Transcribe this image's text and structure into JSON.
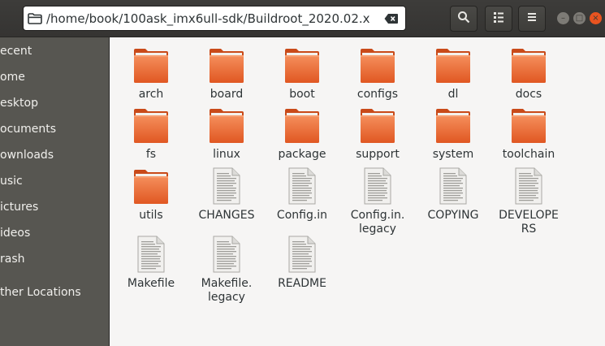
{
  "location": {
    "path": "/home/book/100ask_imx6ull-sdk/Buildroot_2020.02.x"
  },
  "header_buttons": [
    "search-icon",
    "view-list-icon",
    "menu-icon"
  ],
  "window_controls": {
    "minimize": "–",
    "maximize": "□",
    "close": "×"
  },
  "colors": {
    "accent": "#e95420",
    "sidebar_bg": "#575651",
    "header_bg": "#3d3c3a",
    "content_bg": "#f6f5f4"
  },
  "sidebar": {
    "items": [
      {
        "label": "ecent"
      },
      {
        "label": "ome"
      },
      {
        "label": "esktop"
      },
      {
        "label": "ocuments"
      },
      {
        "label": "ownloads"
      },
      {
        "label": "usic"
      },
      {
        "label": "ictures"
      },
      {
        "label": "ideos"
      },
      {
        "label": "rash"
      },
      {
        "label": "ther Locations"
      }
    ]
  },
  "files": [
    {
      "name": "arch",
      "type": "folder"
    },
    {
      "name": "board",
      "type": "folder"
    },
    {
      "name": "boot",
      "type": "folder"
    },
    {
      "name": "configs",
      "type": "folder"
    },
    {
      "name": "dl",
      "type": "folder"
    },
    {
      "name": "docs",
      "type": "folder"
    },
    {
      "name": "fs",
      "type": "folder"
    },
    {
      "name": "linux",
      "type": "folder"
    },
    {
      "name": "package",
      "type": "folder"
    },
    {
      "name": "support",
      "type": "folder"
    },
    {
      "name": "system",
      "type": "folder"
    },
    {
      "name": "toolchain",
      "type": "folder"
    },
    {
      "name": "utils",
      "type": "folder"
    },
    {
      "name": "CHANGES",
      "type": "text-file"
    },
    {
      "name": "Config.in",
      "type": "text-file"
    },
    {
      "name": "Config.in.\nlegacy",
      "type": "text-file"
    },
    {
      "name": "COPYING",
      "type": "text-file"
    },
    {
      "name": "DEVELOPE\nRS",
      "type": "text-file"
    },
    {
      "name": "Makefile",
      "type": "text-file"
    },
    {
      "name": "Makefile.\nlegacy",
      "type": "text-file"
    },
    {
      "name": "README",
      "type": "text-file"
    }
  ]
}
